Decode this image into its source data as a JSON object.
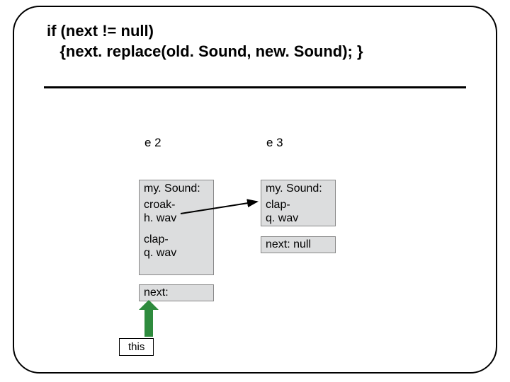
{
  "title": {
    "line1": "if (next != null)",
    "line2": "   {next. replace(old. Sound, new. Sound); }"
  },
  "objects": {
    "e2": {
      "label": "e 2",
      "mySoundLabel": "my. Sound:",
      "mySoundValue": "croak-\nh. wav",
      "currentValue": "clap-\nq. wav",
      "nextLabel": "next:"
    },
    "e3": {
      "label": "e 3",
      "mySoundLabel": "my. Sound:",
      "mySoundValue": "clap-\nq. wav",
      "nextLabel": "next: null"
    }
  },
  "thisLabel": "this",
  "colors": {
    "boxFill": "#dcddde",
    "arrowGreen": "#2e8b3d",
    "arrowBlack": "#000000"
  }
}
